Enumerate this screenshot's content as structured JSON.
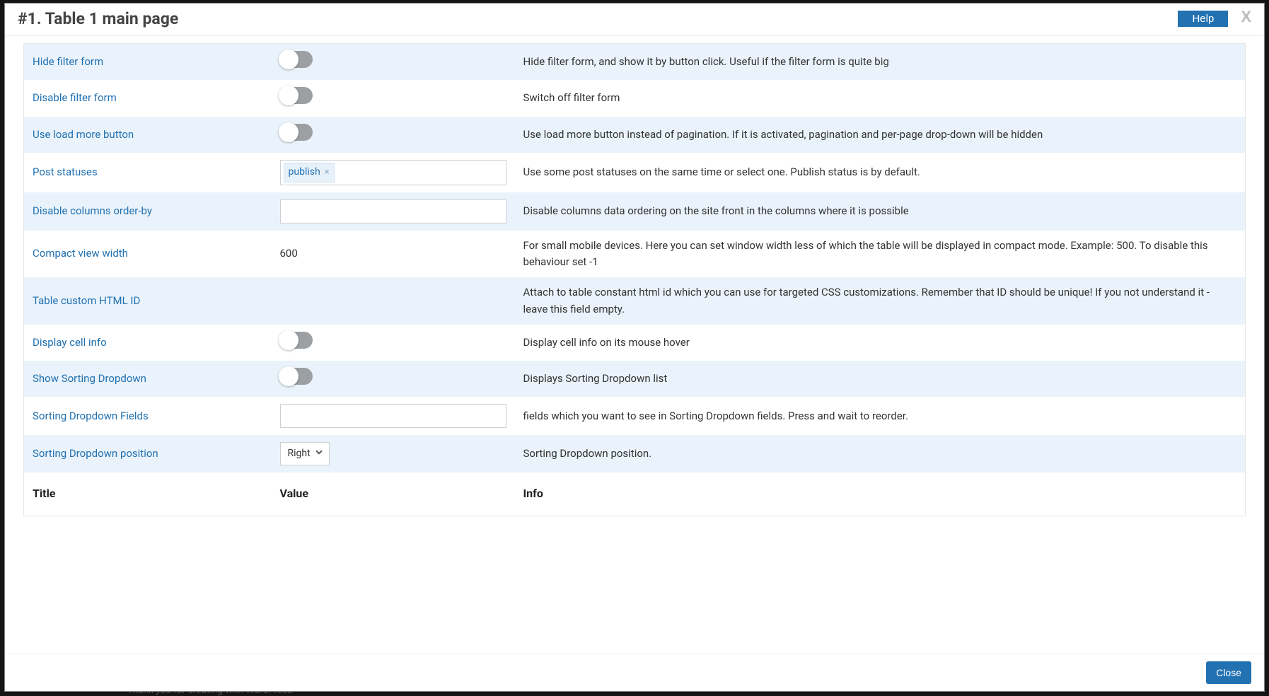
{
  "header": {
    "title": "#1. Table 1 main page",
    "help_label": "Help",
    "close_x": "X"
  },
  "columns": {
    "title": "Title",
    "value": "Value",
    "info": "Info"
  },
  "rows": [
    {
      "id": "hide-filter-form",
      "label": "Hide filter form",
      "control": "toggle",
      "value": "off",
      "info": "Hide filter form, and show it by button click. Useful if the filter form is quite big"
    },
    {
      "id": "disable-filter-form",
      "label": "Disable filter form",
      "control": "toggle",
      "value": "off",
      "info": "Switch off filter form"
    },
    {
      "id": "use-load-more-button",
      "label": "Use load more button",
      "control": "toggle",
      "value": "off",
      "info": "Use load more button instead of pagination. If it is activated, pagination and per-page drop-down will be hidden"
    },
    {
      "id": "post-statuses",
      "label": "Post statuses",
      "control": "tags",
      "tags": [
        "publish"
      ],
      "info": "Use some post statuses on the same time or select one. Publish status is by default."
    },
    {
      "id": "disable-columns-order-by",
      "label": "Disable columns order-by",
      "control": "text",
      "value": "",
      "info": "Disable columns data ordering on the site front in the columns where it is possible"
    },
    {
      "id": "compact-view-width",
      "label": "Compact view width",
      "control": "plain",
      "value": "600",
      "info": "For small mobile devices. Here you can set window width less of which the table will be displayed in compact mode. Example: 500. To disable this behaviour set -1"
    },
    {
      "id": "table-custom-html-id",
      "label": "Table custom HTML ID",
      "control": "none",
      "value": "",
      "info": "Attach to table constant html id which you can use for targeted CSS customizations. Remember that ID should be unique! If you not understand it - leave this field empty."
    },
    {
      "id": "display-cell-info",
      "label": "Display cell info",
      "control": "toggle",
      "value": "off",
      "info": "Display cell info on its mouse hover"
    },
    {
      "id": "show-sorting-dropdown",
      "label": "Show Sorting Dropdown",
      "control": "toggle",
      "value": "off",
      "info": "Displays Sorting Dropdown list"
    },
    {
      "id": "sorting-dropdown-fields",
      "label": "Sorting Dropdown Fields",
      "control": "text",
      "value": "",
      "info": "fields which you want to see in Sorting Dropdown fields. Press and wait to reorder."
    },
    {
      "id": "sorting-dropdown-position",
      "label": "Sorting Dropdown position",
      "control": "select",
      "value": "Right",
      "info": "Sorting Dropdown position."
    }
  ],
  "footer": {
    "close_label": "Close"
  },
  "background": {
    "wp_credit": "Thank you for creating with WordPress"
  }
}
